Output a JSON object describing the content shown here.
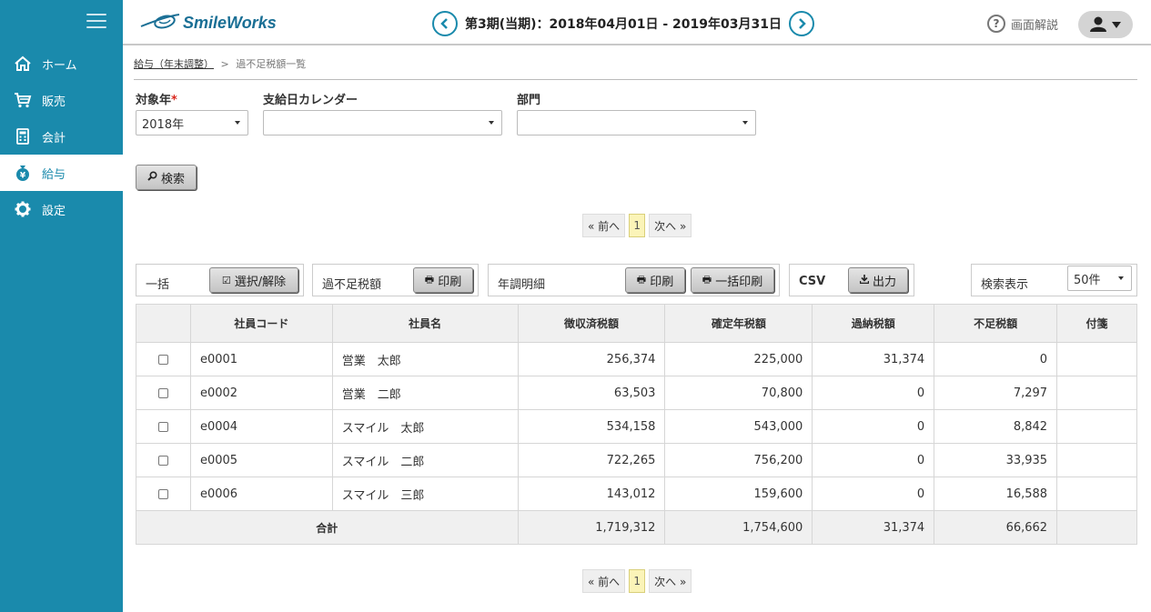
{
  "header": {
    "logo_text": "SmileWorks",
    "period_text": "第3期(当期)：2018年04月01日 - 2019年03月31日",
    "help_label": "画面解説"
  },
  "sidebar": {
    "items": [
      {
        "label": "ホーム",
        "icon": "home-icon"
      },
      {
        "label": "販売",
        "icon": "cart-icon"
      },
      {
        "label": "会計",
        "icon": "calculator-icon"
      },
      {
        "label": "給与",
        "icon": "money-bag-icon",
        "active": true
      },
      {
        "label": "設定",
        "icon": "gear-icon"
      }
    ]
  },
  "breadcrumb": {
    "parent": "給与（年末調整）",
    "separator": ">",
    "current": "過不足税額一覧"
  },
  "filters": {
    "year_label": "対象年",
    "required_mark": "*",
    "year_value": "2018年",
    "calendar_label": "支給日カレンダー",
    "calendar_value": "",
    "dept_label": "部門",
    "dept_value": "",
    "search_button": "検索"
  },
  "pager": {
    "prev": "« 前へ",
    "page": "1",
    "next": "次へ »"
  },
  "actions": {
    "bulk_label": "一括",
    "select_toggle": "選択/解除",
    "shortage_label": "過不足税額",
    "print": "印刷",
    "detail_label": "年調明細",
    "print2": "印刷",
    "bulk_print": "一括印刷",
    "csv_label": "CSV",
    "export": "出力",
    "display_label": "検索表示",
    "display_value": "50件"
  },
  "table": {
    "headers": [
      "",
      "社員コード",
      "社員名",
      "徴収済税額",
      "確定年税額",
      "過納税額",
      "不足税額",
      "付箋"
    ],
    "rows": [
      {
        "code": "e0001",
        "name": "営業　太郎",
        "collected": "256,374",
        "confirmed": "225,000",
        "over": "31,374",
        "short": "0",
        "note": ""
      },
      {
        "code": "e0002",
        "name": "営業　二郎",
        "collected": "63,503",
        "confirmed": "70,800",
        "over": "0",
        "short": "7,297",
        "note": ""
      },
      {
        "code": "e0004",
        "name": "スマイル　太郎",
        "collected": "534,158",
        "confirmed": "543,000",
        "over": "0",
        "short": "8,842",
        "note": ""
      },
      {
        "code": "e0005",
        "name": "スマイル　二郎",
        "collected": "722,265",
        "confirmed": "756,200",
        "over": "0",
        "short": "33,935",
        "note": ""
      },
      {
        "code": "e0006",
        "name": "スマイル　三郎",
        "collected": "143,012",
        "confirmed": "159,600",
        "over": "0",
        "short": "16,588",
        "note": ""
      }
    ],
    "total": {
      "label": "合計",
      "collected": "1,719,312",
      "confirmed": "1,754,600",
      "over": "31,374",
      "short": "66,662"
    }
  },
  "colors": {
    "sidebar": "#1a8aac",
    "accent": "#1a8aac",
    "required": "#d9261c"
  }
}
